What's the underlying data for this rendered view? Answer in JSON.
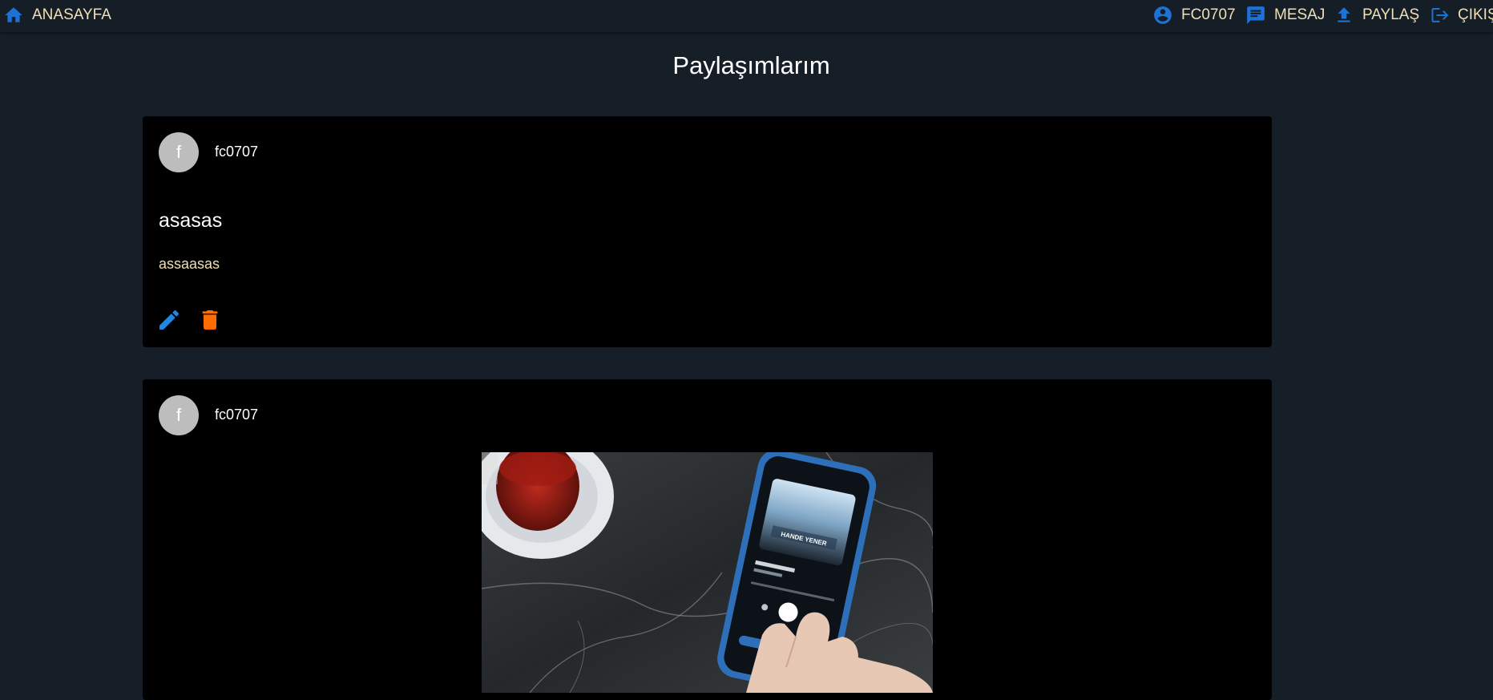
{
  "nav": {
    "home_label": "ANASAYFA",
    "profile_label": "FC0707",
    "messages_label": "MESAJ",
    "share_label": "PAYLAŞ",
    "logout_label": "ÇIKIŞ"
  },
  "page": {
    "title": "Paylaşımlarım"
  },
  "posts": [
    {
      "avatar_letter": "f",
      "username": "fc0707",
      "title": "asasas",
      "body": "assaasas",
      "actions": {
        "edit_icon": "pencil-icon",
        "delete_icon": "trash-icon"
      }
    },
    {
      "avatar_letter": "f",
      "username": "fc0707",
      "image": "photo of a hand tapping a phone playing music next to a tea glass on marble table"
    }
  ],
  "colors": {
    "background": "#161f28",
    "navbar": "#151e27",
    "card": "#000000",
    "accent_blue": "#1d72d6",
    "nav_text": "#f2dfb3",
    "edit_icon": "#1e88e5",
    "delete_icon": "#ff6d00",
    "avatar": "#bdbdbd"
  }
}
